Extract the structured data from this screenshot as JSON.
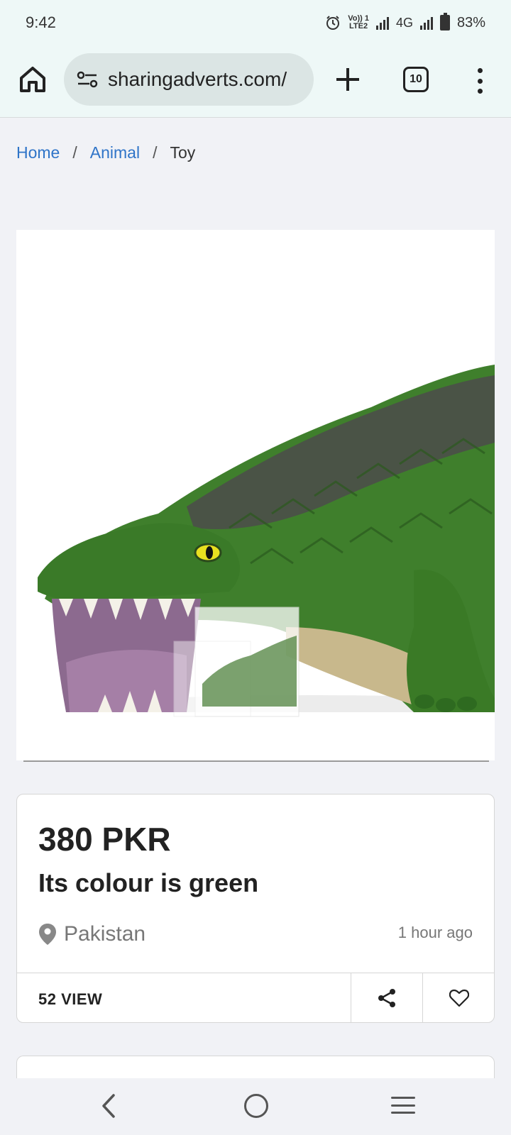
{
  "status": {
    "time": "9:42",
    "volte_top": "Vo)) 1",
    "volte_bottom": "LTE2",
    "network": "4G",
    "battery": "83%"
  },
  "browser": {
    "url": "sharingadverts.com/",
    "tab_count": "10"
  },
  "breadcrumb": {
    "home": "Home",
    "sep": "/",
    "category": "Animal",
    "current": "Toy"
  },
  "listing": {
    "image_alt": "Green toy crocodile",
    "price": "380 PKR",
    "title": "Its colour is green",
    "location": "Pakistan",
    "posted": "1 hour ago",
    "views": "52 VIEW"
  },
  "colors": {
    "link": "#2f74c8",
    "toolbar_bg": "#eef8f7",
    "croc_green": "#3f7f2c"
  }
}
